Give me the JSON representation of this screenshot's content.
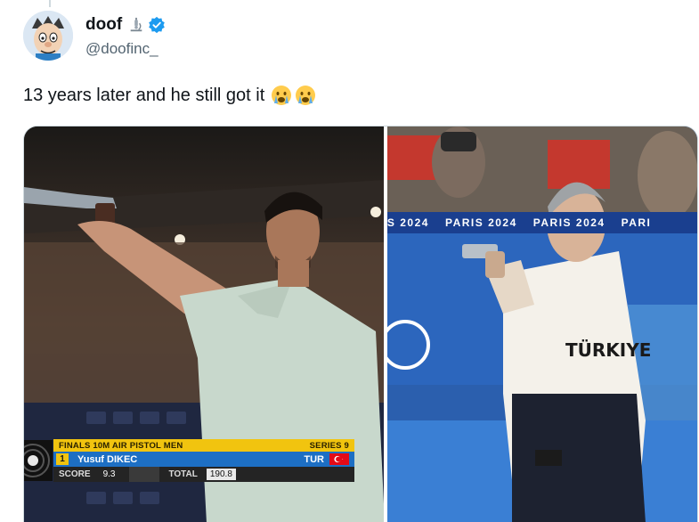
{
  "tweet": {
    "display_name": "doof",
    "name_emoji": "microscope-emoji",
    "verified": true,
    "handle": "@doofinc_",
    "text": "13 years later and he still got it",
    "text_emojis": [
      "crying-face-emoji",
      "crying-face-emoji"
    ]
  },
  "media": {
    "left_photo": {
      "scoreboard": {
        "event": "FINALS 10M AIR PISTOL MEN",
        "series": "SERIES  9",
        "rank": "1",
        "athlete": "Yusuf DIKEC",
        "nation": "TUR",
        "score_label": "SCORE",
        "score": "9.3",
        "total_label": "TOTAL",
        "total": "190.8"
      }
    },
    "right_photo": {
      "banner_text": [
        "S 2024",
        "PARIS 2024",
        "PARIS 2024",
        "PARI"
      ],
      "shirt_text": "TÜRKIYE"
    }
  },
  "colors": {
    "verified_blue": "#1d9bf0",
    "handle_gray": "#536471",
    "scoreboard_yellow": "#f1c40f",
    "scoreboard_blue": "#1d6fc4",
    "paris_banner_blue": "#1a3f8f"
  }
}
